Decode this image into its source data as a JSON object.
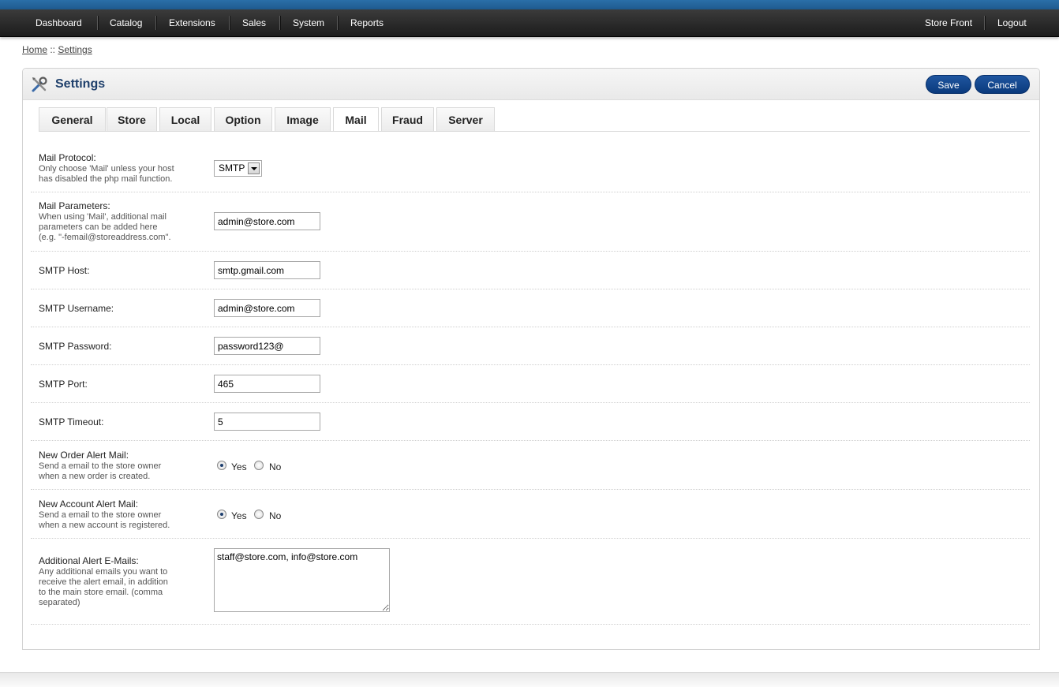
{
  "nav": {
    "left": [
      "Dashboard",
      "Catalog",
      "Extensions",
      "Sales",
      "System",
      "Reports"
    ],
    "right": [
      "Store Front",
      "Logout"
    ]
  },
  "breadcrumb": {
    "home": "Home",
    "sep": " :: ",
    "current": "Settings"
  },
  "header": {
    "title": "Settings",
    "save_label": "Save",
    "cancel_label": "Cancel",
    "icon": "tools-icon"
  },
  "tabs": [
    "General",
    "Store",
    "Local",
    "Option",
    "Image",
    "Mail",
    "Fraud",
    "Server"
  ],
  "active_tab": "Mail",
  "form": {
    "mail_protocol": {
      "label": "Mail Protocol:",
      "help1": "Only choose 'Mail' unless your host",
      "help2": "has disabled the php mail function.",
      "value": "SMTP"
    },
    "mail_parameters": {
      "label": "Mail Parameters:",
      "help1": "When using 'Mail', additional mail",
      "help2": "parameters can be added here",
      "help3": "(e.g. \"-femail@storeaddress.com\".",
      "value": "admin@store.com"
    },
    "smtp_host": {
      "label": "SMTP Host:",
      "value": "smtp.gmail.com"
    },
    "smtp_username": {
      "label": "SMTP Username:",
      "value": "admin@store.com"
    },
    "smtp_password": {
      "label": "SMTP Password:",
      "value": "password123@"
    },
    "smtp_port": {
      "label": "SMTP Port:",
      "value": "465"
    },
    "smtp_timeout": {
      "label": "SMTP Timeout:",
      "value": "5"
    },
    "order_alert": {
      "label": "New Order Alert Mail:",
      "help1": "Send a email to the store owner",
      "help2": "when a new order is created.",
      "yes": "Yes",
      "no": "No",
      "selected": "Yes"
    },
    "account_alert": {
      "label": "New Account Alert Mail:",
      "help1": "Send a email to the store owner",
      "help2": "when a new account is registered.",
      "yes": "Yes",
      "no": "No",
      "selected": "Yes"
    },
    "additional_emails": {
      "label": "Additional Alert E-Mails:",
      "help1": "Any additional emails you want to",
      "help2": "receive the alert email, in addition",
      "help3": "to the main store email. (comma",
      "help4": "separated)",
      "value": "staff@store.com, info@store.com"
    }
  }
}
